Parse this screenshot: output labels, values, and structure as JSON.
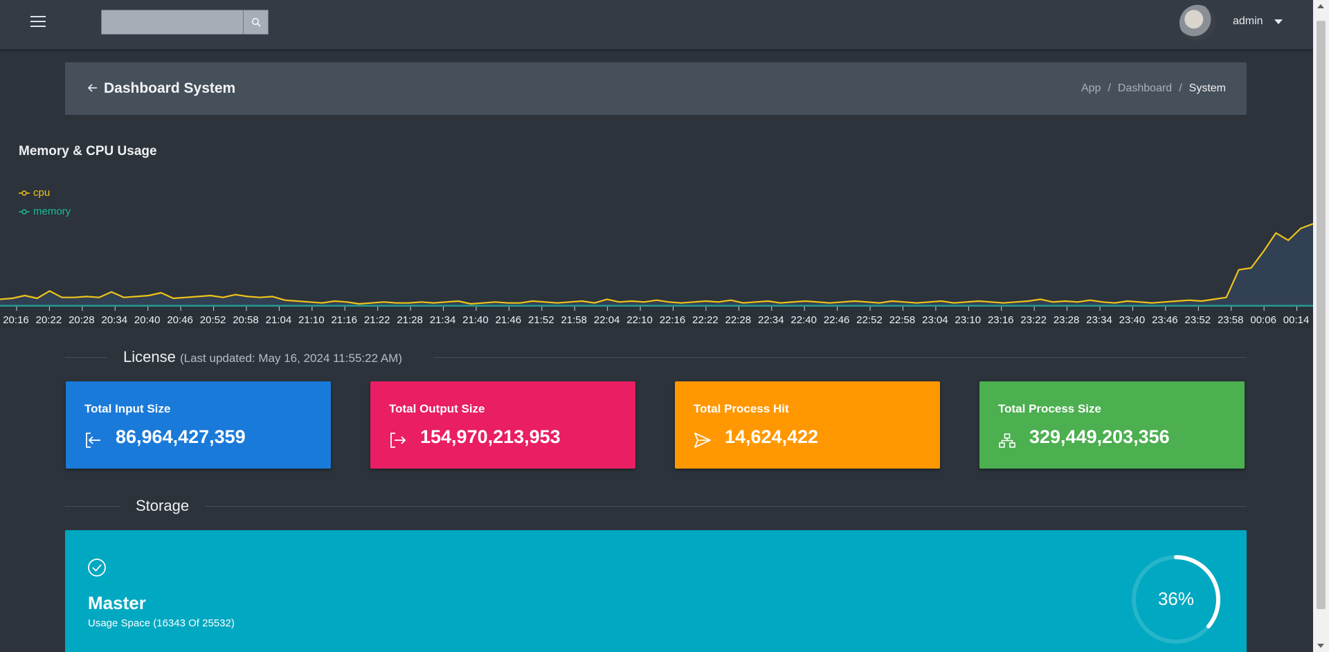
{
  "topbar": {
    "search": {
      "value": "",
      "placeholder": ""
    },
    "user": {
      "name": "admin"
    }
  },
  "header": {
    "title": "Dashboard System",
    "breadcrumb": [
      "App",
      "Dashboard",
      "System"
    ]
  },
  "chart": {
    "title": "Memory & CPU Usage",
    "legend": [
      {
        "label": "cpu",
        "color": "#f0c419"
      },
      {
        "label": "memory",
        "color": "#1abc9c"
      }
    ]
  },
  "chart_data": {
    "type": "line",
    "title": "Memory & CPU Usage",
    "xlabel": "",
    "ylabel": "",
    "legend": "top-left",
    "grid": false,
    "x_ticks": [
      "20:16",
      "20:22",
      "20:28",
      "20:34",
      "20:40",
      "20:46",
      "20:52",
      "20:58",
      "21:04",
      "21:10",
      "21:16",
      "21:22",
      "21:28",
      "21:34",
      "21:40",
      "21:46",
      "21:52",
      "21:58",
      "22:04",
      "22:10",
      "22:16",
      "22:22",
      "22:28",
      "22:34",
      "22:40",
      "22:46",
      "22:52",
      "22:58",
      "23:04",
      "23:10",
      "23:16",
      "23:22",
      "23:28",
      "23:34",
      "23:40",
      "23:46",
      "23:52",
      "23:58",
      "00:06",
      "00:14"
    ],
    "series": [
      {
        "name": "cpu",
        "color": "#f0c419",
        "values": [
          8,
          9,
          12,
          9,
          17,
          10,
          10,
          11,
          10,
          16,
          10,
          11,
          12,
          15,
          9,
          10,
          11,
          12,
          10,
          13,
          11,
          10,
          11,
          7,
          6,
          5,
          4,
          6,
          5,
          3,
          4,
          5,
          4,
          4,
          5,
          4,
          5,
          6,
          3,
          4,
          5,
          4,
          4,
          6,
          5,
          4,
          5,
          6,
          4,
          8,
          5,
          6,
          5,
          7,
          5,
          4,
          5,
          6,
          5,
          7,
          4,
          5,
          6,
          4,
          5,
          6,
          5,
          4,
          5,
          6,
          5,
          4,
          6,
          5,
          4,
          5,
          6,
          4,
          5,
          6,
          5,
          4,
          5,
          6,
          8,
          5,
          6,
          5,
          7,
          5,
          4,
          6,
          5,
          4,
          5,
          6,
          7,
          6,
          8,
          10,
          40,
          42,
          60,
          80,
          72,
          85,
          90
        ]
      },
      {
        "name": "memory",
        "color": "#1abc9c",
        "values": [
          1,
          1,
          1,
          1,
          1,
          1,
          1,
          1,
          1,
          1,
          1,
          1,
          1,
          1,
          1,
          1,
          1,
          1,
          1,
          1,
          1,
          1,
          1,
          1,
          1,
          1,
          1,
          1,
          1,
          1,
          1,
          1,
          1,
          1,
          1,
          1,
          1,
          1,
          1,
          1,
          1,
          1,
          1,
          1,
          1,
          1,
          1,
          1,
          1,
          1,
          1,
          1,
          1,
          1,
          1,
          1,
          1,
          1,
          1,
          1,
          1,
          1,
          1,
          1,
          1,
          1,
          1,
          1,
          1,
          1,
          1,
          1,
          1,
          1,
          1,
          1,
          1,
          1,
          1,
          1,
          1,
          1,
          1,
          1,
          1,
          1,
          1,
          1,
          1,
          1,
          1,
          1,
          1,
          1,
          1,
          1,
          1,
          1,
          1,
          1,
          1,
          1,
          1,
          1,
          1,
          1,
          1
        ]
      }
    ]
  },
  "license": {
    "title": "License",
    "updated": "(Last updated: May 16, 2024 11:55:22 AM)",
    "cards": [
      {
        "label": "Total Input Size",
        "value": "86,964,427,359",
        "color": "#1a7ad9",
        "icon": "sign-in-icon"
      },
      {
        "label": "Total Output Size",
        "value": "154,970,213,953",
        "color": "#e91e63",
        "icon": "sign-out-icon"
      },
      {
        "label": "Total Process Hit",
        "value": "14,624,422",
        "color": "#ff9800",
        "icon": "send-icon"
      },
      {
        "label": "Total Process Size",
        "value": "329,449,203,356",
        "color": "#4caf50",
        "icon": "sitemap-icon"
      }
    ]
  },
  "storage": {
    "title": "Storage",
    "name": "Master",
    "usage": "Usage Space (16343 Of 25532)",
    "percent_label": "36%",
    "percent": 0.36,
    "color": "#00a8c1"
  }
}
